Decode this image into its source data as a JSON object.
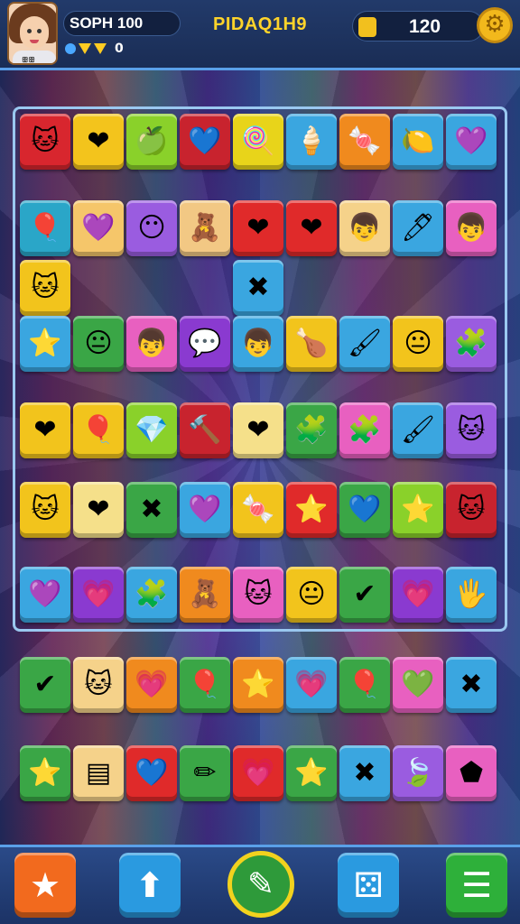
{
  "header": {
    "player_name": "SOPH 100",
    "gem_count": "0",
    "title": "PIDAQ1H9",
    "coins": "120",
    "avatar_tag": "ꕥꕥ"
  },
  "board": {
    "rows": [
      [
        [
          "#d8262e",
          "🐱"
        ],
        [
          "#f3c41c",
          "❤"
        ],
        [
          "#8ad12a",
          "🍏"
        ],
        [
          "#c8232e",
          "💙"
        ],
        [
          "#e8d41a",
          "🍭"
        ],
        [
          "#3aa6e0",
          "🍦"
        ],
        [
          "#f08a1e",
          "🍬"
        ],
        [
          "#3aa6e0",
          "🍋"
        ],
        [
          "#3aa6e0",
          "💜"
        ]
      ],
      [
        [
          "#2aa6c8",
          "🎈"
        ],
        [
          "#f5c66a",
          "💜"
        ],
        [
          "#9a5ce0",
          "😶"
        ],
        [
          "#f2c884",
          "🧸"
        ],
        [
          "#e02a2a",
          "❤"
        ],
        [
          "#e02a2a",
          "❤"
        ],
        [
          "#f5d28a",
          "👦"
        ],
        [
          "#3aa6e0",
          "🖊"
        ],
        [
          "#e860c0",
          "👦"
        ]
      ],
      [
        [
          "#f2c41c",
          "🐱"
        ],
        null,
        null,
        null,
        [
          "#3aa6e0",
          "✖"
        ],
        null,
        null,
        null,
        null
      ],
      [
        [
          "#3aa6e0",
          "⭐"
        ],
        [
          "#3aa646",
          "😐"
        ],
        [
          "#e860c0",
          "👦"
        ],
        [
          "#8a3ad0",
          "💬"
        ],
        [
          "#3aa6e0",
          "👦"
        ],
        [
          "#f2c41c",
          "🍗"
        ],
        [
          "#3aa6e0",
          "🖌"
        ],
        [
          "#f2c41c",
          "😐"
        ],
        [
          "#9a5ce0",
          "🧩"
        ]
      ],
      [
        [
          "#f2c41c",
          "❤"
        ],
        [
          "#f2c41c",
          "🎈"
        ],
        [
          "#8ad12a",
          "💎"
        ],
        [
          "#c8232e",
          "🔨"
        ],
        [
          "#f5e08a",
          "❤"
        ],
        [
          "#3aa646",
          "🧩"
        ],
        [
          "#e860c0",
          "🧩"
        ],
        [
          "#3aa6e0",
          "🖌"
        ],
        [
          "#9a5ce0",
          "🐱"
        ]
      ],
      [
        [
          "#f2c41c",
          "🐱"
        ],
        [
          "#f5e08a",
          "❤"
        ],
        [
          "#3aa646",
          "✖"
        ],
        [
          "#3aa6e0",
          "💜"
        ],
        [
          "#f2c41c",
          "🍬"
        ],
        [
          "#e02a2a",
          "⭐"
        ],
        [
          "#3aa646",
          "💙"
        ],
        [
          "#8ad12a",
          "⭐"
        ],
        [
          "#c8232e",
          "🐱"
        ]
      ],
      [
        [
          "#3aa6e0",
          "💜"
        ],
        [
          "#8a3ad0",
          "💗"
        ],
        [
          "#3aa6e0",
          "🧩"
        ],
        [
          "#f08a1e",
          "🧸"
        ],
        [
          "#e860c0",
          "🐱"
        ],
        [
          "#f2c41c",
          "😐"
        ],
        [
          "#3aa646",
          "✔"
        ],
        [
          "#8a3ad0",
          "💗"
        ],
        [
          "#3aa6e0",
          "🖐"
        ]
      ],
      [
        [
          "#3aa646",
          "✔"
        ],
        [
          "#f5d28a",
          "🐱"
        ],
        [
          "#f08a1e",
          "💗"
        ],
        [
          "#3aa646",
          "🎈"
        ],
        [
          "#f08a1e",
          "⭐"
        ],
        [
          "#3aa6e0",
          "💗"
        ],
        [
          "#3aa646",
          "🎈"
        ],
        [
          "#e860c0",
          "💚"
        ],
        [
          "#3aa6e0",
          "✖"
        ]
      ],
      [
        [
          "#3aa646",
          "⭐"
        ],
        [
          "#f5d28a",
          "▤"
        ],
        [
          "#e02a2a",
          "💙"
        ],
        [
          "#3aa646",
          "✏"
        ],
        [
          "#e02a2a",
          "💗"
        ],
        [
          "#3aa646",
          "⭐"
        ],
        [
          "#3aa6e0",
          "✖"
        ],
        [
          "#9a5ce0",
          "🍃"
        ],
        [
          "#e860c0",
          "⬟"
        ]
      ]
    ]
  },
  "toolbar": {
    "buttons": [
      {
        "name": "star-button",
        "glyph": "★",
        "color": "#f26a1e"
      },
      {
        "name": "arrow-up-button",
        "glyph": "⬆",
        "color": "#2a9ae0"
      },
      {
        "name": "shuffle-button",
        "glyph": "✎",
        "color": "#2e9a3a"
      },
      {
        "name": "dice-button",
        "glyph": "⚄",
        "color": "#2a9ae0"
      },
      {
        "name": "menu-button",
        "glyph": "☰",
        "color": "#2eb03a"
      }
    ]
  }
}
